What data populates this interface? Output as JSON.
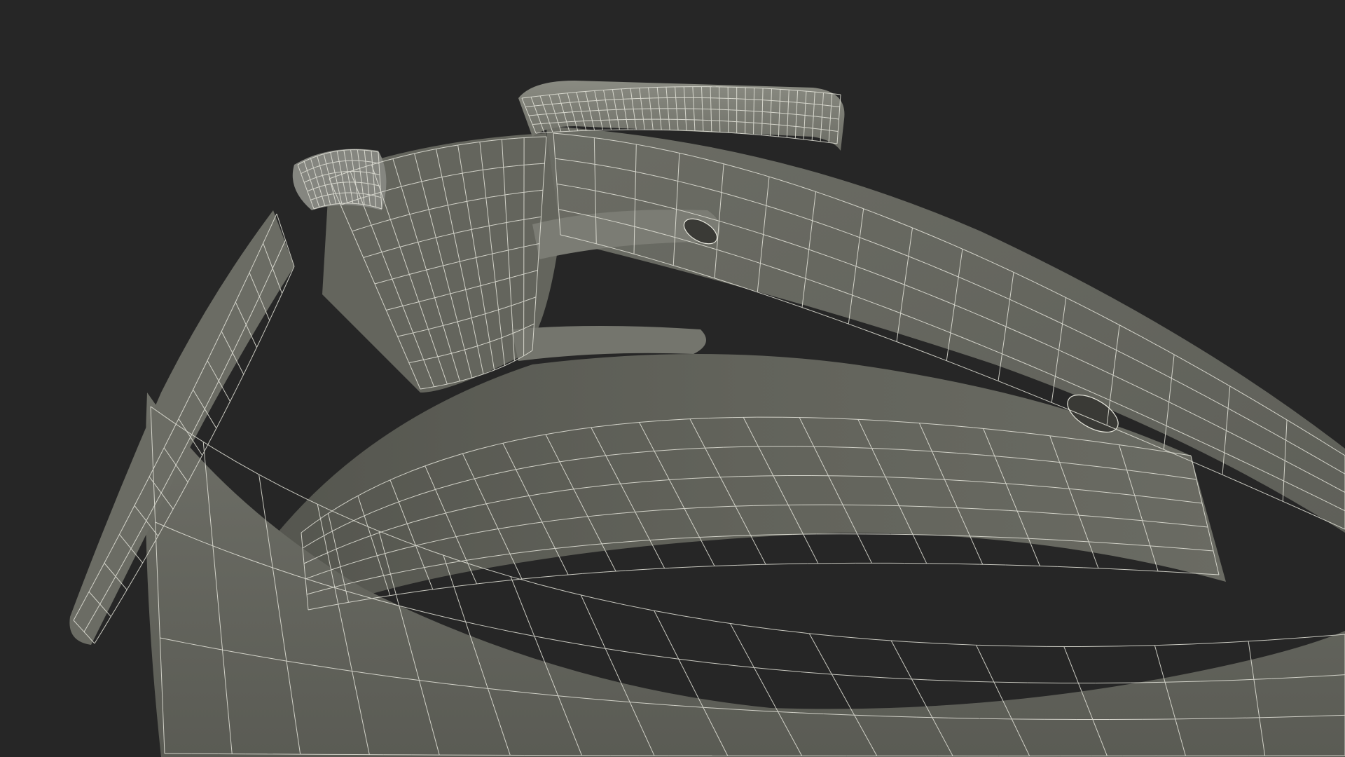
{
  "scene": {
    "subject": "belt-with-buckle-wireframe-render",
    "colors": {
      "background": "#262626",
      "surface_light": "#6e6f66",
      "surface_mid": "#5e5f57",
      "surface_dark": "#4e4f48",
      "wire": "#e6e6dc"
    }
  }
}
